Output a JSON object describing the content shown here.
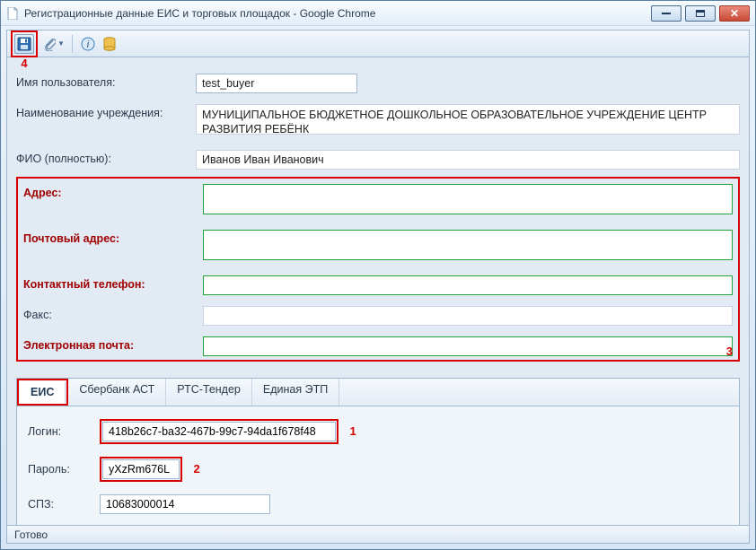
{
  "window": {
    "title": "Регистрационные данные ЕИС и торговых площадок - Google Chrome"
  },
  "toolbar": {
    "save_icon": "save",
    "attach_icon": "attach",
    "info_icon": "info",
    "db_icon": "database"
  },
  "annotations": {
    "a1": "1",
    "a2": "2",
    "a3": "3",
    "a4": "4"
  },
  "form": {
    "username_label": "Имя пользователя:",
    "username_value": "test_buyer",
    "org_label": "Наименование учреждения:",
    "org_value": "МУНИЦИПАЛЬНОЕ БЮДЖЕТНОЕ ДОШКОЛЬНОЕ ОБРАЗОВАТЕЛЬНОЕ УЧРЕЖДЕНИЕ ЦЕНТР РАЗВИТИЯ РЕБЁНК",
    "fullname_label": "ФИО (полностью):",
    "fullname_value": "Иванов Иван Иванович",
    "address_label": "Адрес:",
    "address_value": "",
    "postal_label": "Почтовый адрес:",
    "postal_value": "",
    "phone_label": "Контактный телефон:",
    "phone_value": "",
    "fax_label": "Факс:",
    "fax_value": "",
    "email_label": "Электронная почта:",
    "email_value": ""
  },
  "tabs": {
    "t0": "ЕИС",
    "t1": "Сбербанк АСТ",
    "t2": "РТС-Тендер",
    "t3": "Единая ЭТП"
  },
  "eis": {
    "login_label": "Логин:",
    "login_value": "418b26c7-ba32-467b-99c7-94da1f678f48",
    "password_label": "Пароль:",
    "password_value": "yXzRm676L",
    "spz_label": "СПЗ:",
    "spz_value": "10683000014"
  },
  "status": {
    "text": "Готово"
  }
}
